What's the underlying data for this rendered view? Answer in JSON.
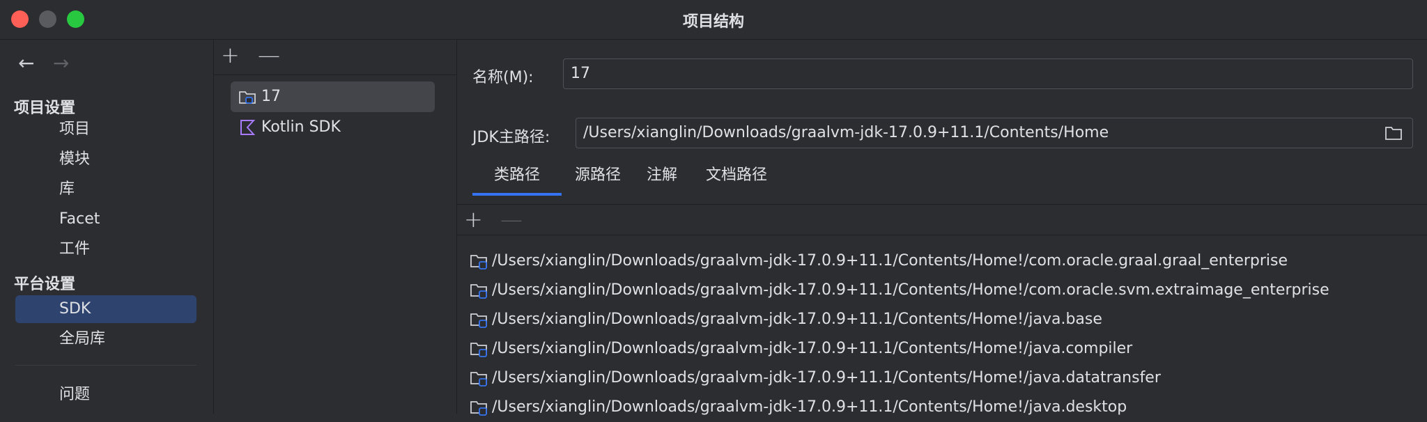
{
  "window": {
    "title": "项目结构"
  },
  "nav": {
    "back_icon": "arrow-left-icon",
    "forward_icon": "arrow-right-icon",
    "project_settings": {
      "title": "项目设置",
      "items": [
        "项目",
        "模块",
        "库",
        "Facet",
        "工件"
      ]
    },
    "platform_settings": {
      "title": "平台设置",
      "items": [
        "SDK",
        "全局库"
      ],
      "selected": "SDK"
    },
    "problems": "问题"
  },
  "sdk_list": {
    "add_icon": "plus-icon",
    "remove_icon": "minus-icon",
    "items": [
      {
        "label": "17",
        "icon": "jdk-folder-icon",
        "selected": true
      },
      {
        "label": "Kotlin SDK",
        "icon": "kotlin-icon",
        "selected": false
      }
    ]
  },
  "details": {
    "name_label": "名称(M):",
    "name_value": "17",
    "jdk_path_label": "JDK主路径:",
    "jdk_path_value": "/Users/xianglin/Downloads/graalvm-jdk-17.0.9+11.1/Contents/Home",
    "tabs": [
      "类路径",
      "源路径",
      "注解",
      "文档路径"
    ],
    "active_tab": "类路径",
    "classpath": [
      "/Users/xianglin/Downloads/graalvm-jdk-17.0.9+11.1/Contents/Home!/com.oracle.graal.graal_enterprise",
      "/Users/xianglin/Downloads/graalvm-jdk-17.0.9+11.1/Contents/Home!/com.oracle.svm.extraimage_enterprise",
      "/Users/xianglin/Downloads/graalvm-jdk-17.0.9+11.1/Contents/Home!/java.base",
      "/Users/xianglin/Downloads/graalvm-jdk-17.0.9+11.1/Contents/Home!/java.compiler",
      "/Users/xianglin/Downloads/graalvm-jdk-17.0.9+11.1/Contents/Home!/java.datatransfer",
      "/Users/xianglin/Downloads/graalvm-jdk-17.0.9+11.1/Contents/Home!/java.desktop"
    ]
  },
  "colors": {
    "background": "#2b2d30",
    "selection": "#2e436e",
    "accent": "#3574f0",
    "text": "#dfe1e5"
  }
}
